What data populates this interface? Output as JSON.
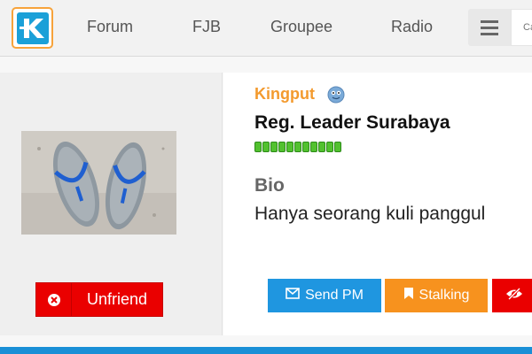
{
  "nav": {
    "items": [
      {
        "label": "Forum"
      },
      {
        "label": "FJB"
      },
      {
        "label": "Groupee"
      },
      {
        "label": "Radio"
      }
    ],
    "search_placeholder": "Ca"
  },
  "profile": {
    "username": "Kingput",
    "rank": "Reg. Leader Surabaya",
    "reputation_segments": 11,
    "bio_label": "Bio",
    "bio_text": "Hanya seorang kuli panggul"
  },
  "actions": {
    "unfriend_label": "Unfriend",
    "send_pm_label": "Send PM",
    "stalking_label": "Stalking"
  },
  "colors": {
    "username": "#f39a2e",
    "send_pm": "#1f96e0",
    "stalking": "#f7921e",
    "unfriend": "#ea0000",
    "reputation": "#52c12f"
  }
}
